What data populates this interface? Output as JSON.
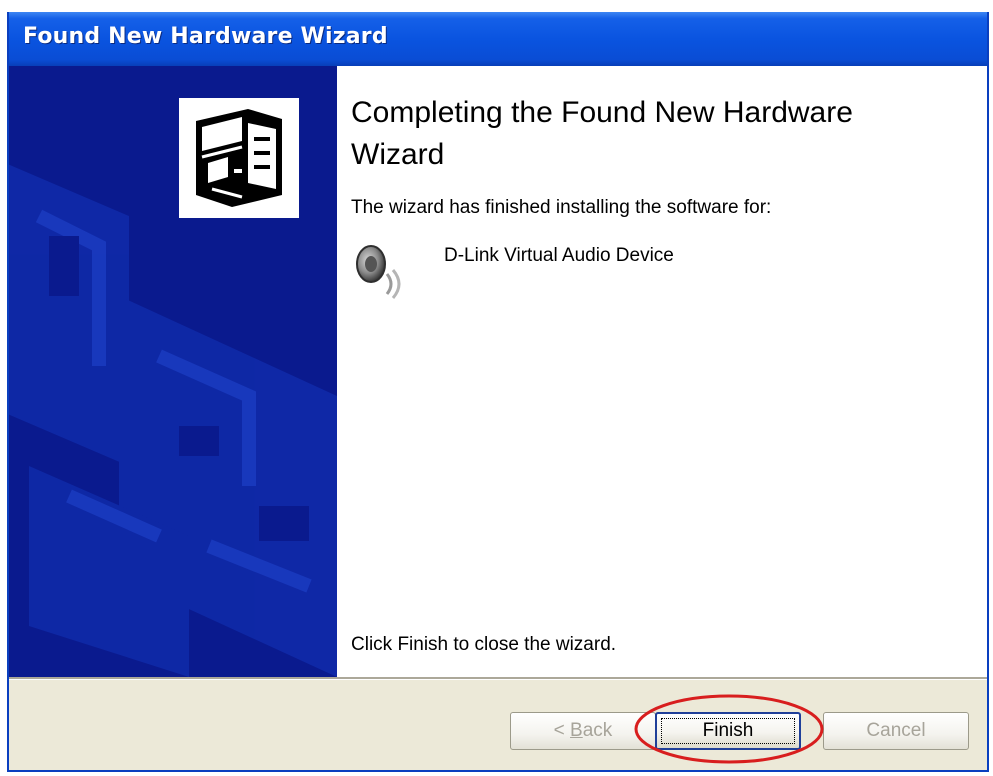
{
  "window": {
    "title": "Found New Hardware Wizard"
  },
  "sidebar": {
    "icon": "hardware-card-icon",
    "background_color": "#0a1a8e"
  },
  "content": {
    "heading": "Completing the Found New Hardware Wizard",
    "subtext": "The wizard has finished installing the software for:",
    "device": {
      "icon": "speaker-icon",
      "name": "D-Link Virtual Audio Device"
    },
    "footer_text": "Click Finish to close the wizard."
  },
  "buttons": {
    "back_label_mnemonic": "B",
    "back_label_rest": "ack",
    "back_prefix": "< ",
    "finish_label": "Finish",
    "cancel_label": "Cancel"
  },
  "annotation": {
    "highlight_color": "#d81e1e"
  },
  "colors": {
    "titlebar": "#0a54e0",
    "dialog_face": "#ece9d8"
  }
}
